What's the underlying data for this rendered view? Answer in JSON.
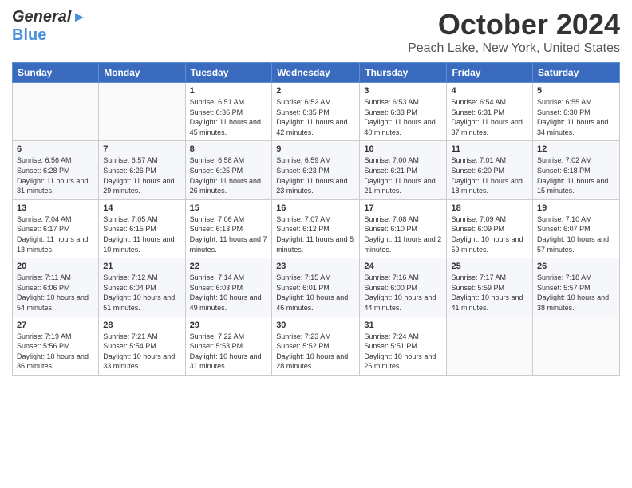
{
  "header": {
    "logo_general": "General",
    "logo_blue": "Blue",
    "title": "October 2024",
    "subtitle": "Peach Lake, New York, United States"
  },
  "weekdays": [
    "Sunday",
    "Monday",
    "Tuesday",
    "Wednesday",
    "Thursday",
    "Friday",
    "Saturday"
  ],
  "weeks": [
    [
      {
        "day": "",
        "info": ""
      },
      {
        "day": "",
        "info": ""
      },
      {
        "day": "1",
        "info": "Sunrise: 6:51 AM\nSunset: 6:36 PM\nDaylight: 11 hours and 45 minutes."
      },
      {
        "day": "2",
        "info": "Sunrise: 6:52 AM\nSunset: 6:35 PM\nDaylight: 11 hours and 42 minutes."
      },
      {
        "day": "3",
        "info": "Sunrise: 6:53 AM\nSunset: 6:33 PM\nDaylight: 11 hours and 40 minutes."
      },
      {
        "day": "4",
        "info": "Sunrise: 6:54 AM\nSunset: 6:31 PM\nDaylight: 11 hours and 37 minutes."
      },
      {
        "day": "5",
        "info": "Sunrise: 6:55 AM\nSunset: 6:30 PM\nDaylight: 11 hours and 34 minutes."
      }
    ],
    [
      {
        "day": "6",
        "info": "Sunrise: 6:56 AM\nSunset: 6:28 PM\nDaylight: 11 hours and 31 minutes."
      },
      {
        "day": "7",
        "info": "Sunrise: 6:57 AM\nSunset: 6:26 PM\nDaylight: 11 hours and 29 minutes."
      },
      {
        "day": "8",
        "info": "Sunrise: 6:58 AM\nSunset: 6:25 PM\nDaylight: 11 hours and 26 minutes."
      },
      {
        "day": "9",
        "info": "Sunrise: 6:59 AM\nSunset: 6:23 PM\nDaylight: 11 hours and 23 minutes."
      },
      {
        "day": "10",
        "info": "Sunrise: 7:00 AM\nSunset: 6:21 PM\nDaylight: 11 hours and 21 minutes."
      },
      {
        "day": "11",
        "info": "Sunrise: 7:01 AM\nSunset: 6:20 PM\nDaylight: 11 hours and 18 minutes."
      },
      {
        "day": "12",
        "info": "Sunrise: 7:02 AM\nSunset: 6:18 PM\nDaylight: 11 hours and 15 minutes."
      }
    ],
    [
      {
        "day": "13",
        "info": "Sunrise: 7:04 AM\nSunset: 6:17 PM\nDaylight: 11 hours and 13 minutes."
      },
      {
        "day": "14",
        "info": "Sunrise: 7:05 AM\nSunset: 6:15 PM\nDaylight: 11 hours and 10 minutes."
      },
      {
        "day": "15",
        "info": "Sunrise: 7:06 AM\nSunset: 6:13 PM\nDaylight: 11 hours and 7 minutes."
      },
      {
        "day": "16",
        "info": "Sunrise: 7:07 AM\nSunset: 6:12 PM\nDaylight: 11 hours and 5 minutes."
      },
      {
        "day": "17",
        "info": "Sunrise: 7:08 AM\nSunset: 6:10 PM\nDaylight: 11 hours and 2 minutes."
      },
      {
        "day": "18",
        "info": "Sunrise: 7:09 AM\nSunset: 6:09 PM\nDaylight: 10 hours and 59 minutes."
      },
      {
        "day": "19",
        "info": "Sunrise: 7:10 AM\nSunset: 6:07 PM\nDaylight: 10 hours and 57 minutes."
      }
    ],
    [
      {
        "day": "20",
        "info": "Sunrise: 7:11 AM\nSunset: 6:06 PM\nDaylight: 10 hours and 54 minutes."
      },
      {
        "day": "21",
        "info": "Sunrise: 7:12 AM\nSunset: 6:04 PM\nDaylight: 10 hours and 51 minutes."
      },
      {
        "day": "22",
        "info": "Sunrise: 7:14 AM\nSunset: 6:03 PM\nDaylight: 10 hours and 49 minutes."
      },
      {
        "day": "23",
        "info": "Sunrise: 7:15 AM\nSunset: 6:01 PM\nDaylight: 10 hours and 46 minutes."
      },
      {
        "day": "24",
        "info": "Sunrise: 7:16 AM\nSunset: 6:00 PM\nDaylight: 10 hours and 44 minutes."
      },
      {
        "day": "25",
        "info": "Sunrise: 7:17 AM\nSunset: 5:59 PM\nDaylight: 10 hours and 41 minutes."
      },
      {
        "day": "26",
        "info": "Sunrise: 7:18 AM\nSunset: 5:57 PM\nDaylight: 10 hours and 38 minutes."
      }
    ],
    [
      {
        "day": "27",
        "info": "Sunrise: 7:19 AM\nSunset: 5:56 PM\nDaylight: 10 hours and 36 minutes."
      },
      {
        "day": "28",
        "info": "Sunrise: 7:21 AM\nSunset: 5:54 PM\nDaylight: 10 hours and 33 minutes."
      },
      {
        "day": "29",
        "info": "Sunrise: 7:22 AM\nSunset: 5:53 PM\nDaylight: 10 hours and 31 minutes."
      },
      {
        "day": "30",
        "info": "Sunrise: 7:23 AM\nSunset: 5:52 PM\nDaylight: 10 hours and 28 minutes."
      },
      {
        "day": "31",
        "info": "Sunrise: 7:24 AM\nSunset: 5:51 PM\nDaylight: 10 hours and 26 minutes."
      },
      {
        "day": "",
        "info": ""
      },
      {
        "day": "",
        "info": ""
      }
    ]
  ]
}
